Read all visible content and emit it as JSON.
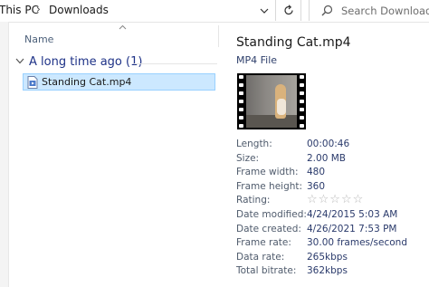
{
  "address_bar": {
    "segments": [
      "This PC",
      "Downloads"
    ],
    "separator": "›"
  },
  "search": {
    "placeholder": "Search Downloads"
  },
  "file_list": {
    "column_header": "Name",
    "group": {
      "label": "A long time ago (1)"
    },
    "items": [
      {
        "name": "Standing Cat.mp4",
        "icon": "mp4-file-icon",
        "selected": true
      }
    ]
  },
  "details": {
    "title": "Standing Cat.mp4",
    "type": "MP4 File",
    "properties": [
      {
        "label": "Length:",
        "value": "00:00:46"
      },
      {
        "label": "Size:",
        "value": "2.00 MB"
      },
      {
        "label": "Frame width:",
        "value": "480"
      },
      {
        "label": "Frame height:",
        "value": "360"
      },
      {
        "label": "Rating:",
        "value": "☆☆☆☆☆",
        "stars": 0
      },
      {
        "label": "Date modified:",
        "value": "4/24/2015 5:03 AM"
      },
      {
        "label": "Date created:",
        "value": "4/26/2021 7:53 PM"
      },
      {
        "label": "Frame rate:",
        "value": "30.00 frames/second"
      },
      {
        "label": "Data rate:",
        "value": "265kbps"
      },
      {
        "label": "Total bitrate:",
        "value": "362kbps"
      }
    ]
  },
  "colors": {
    "selection": "#cce8ff",
    "selection_border": "#99d1ff",
    "group_label": "#1e3287"
  }
}
